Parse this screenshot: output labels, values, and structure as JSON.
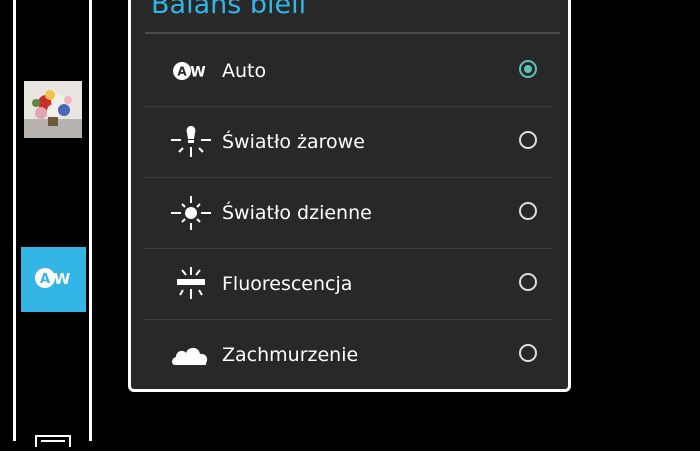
{
  "dialog": {
    "title": "Balans bieli",
    "options": [
      {
        "label": "Auto",
        "icon": "auto-wb-icon",
        "selected": true
      },
      {
        "label": "Światło żarowe",
        "icon": "incandescent-icon",
        "selected": false
      },
      {
        "label": "Światło dzienne",
        "icon": "daylight-icon",
        "selected": false
      },
      {
        "label": "Fluorescencja",
        "icon": "fluorescent-icon",
        "selected": false
      },
      {
        "label": "Zachmurzenie",
        "icon": "cloudy-icon",
        "selected": false
      }
    ]
  },
  "sidebar": {
    "wb_button_icon": "auto-wb-icon",
    "thumbnail": "last-photo-thumbnail",
    "accent": "#33b5e5"
  },
  "colors": {
    "accent": "#33b5e5",
    "radio_checked": "#5ec3b7"
  }
}
